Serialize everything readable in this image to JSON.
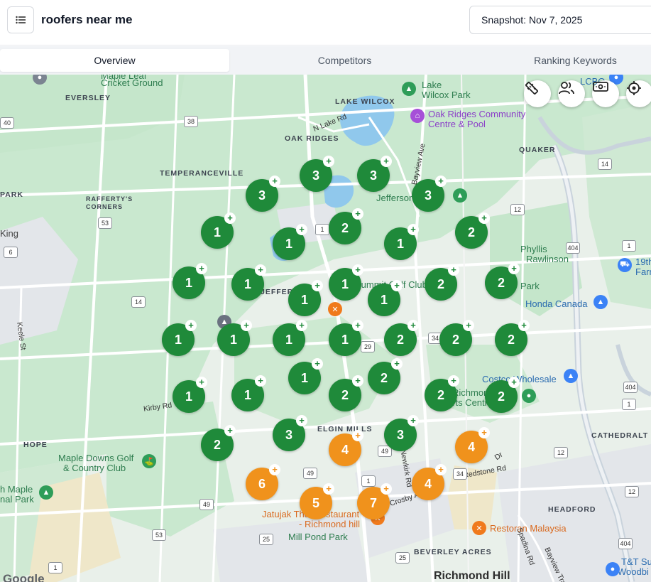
{
  "header": {
    "title": "roofers near me",
    "snapshot": "Snapshot: Nov 7, 2025"
  },
  "tabs": [
    {
      "label": "Overview",
      "active": true
    },
    {
      "label": "Competitors",
      "active": false
    },
    {
      "label": "Ranking Keywords",
      "active": false
    }
  ],
  "colors": {
    "green_marker": "#1f8a3a",
    "orange_marker": "#f0921c",
    "park": "#c9e8cf",
    "water": "#90c8ec",
    "road_major": "#ffffff",
    "highway": "#c9d3dc"
  },
  "map_controls": [
    {
      "name": "ruler-icon"
    },
    {
      "name": "people-icon"
    },
    {
      "name": "cash-icon"
    },
    {
      "name": "crosshair-icon"
    }
  ],
  "markers": [
    {
      "rank": "3"
    },
    {
      "rank": "3"
    },
    {
      "rank": "3"
    },
    {
      "rank": "3"
    },
    {
      "rank": "1"
    },
    {
      "rank": "1"
    },
    {
      "rank": "2"
    },
    {
      "rank": "1"
    },
    {
      "rank": "2"
    },
    {
      "rank": "1"
    },
    {
      "rank": "1"
    },
    {
      "rank": "1"
    },
    {
      "rank": "1"
    },
    {
      "rank": "1"
    },
    {
      "rank": "2"
    },
    {
      "rank": "2"
    },
    {
      "rank": "1"
    },
    {
      "rank": "1"
    },
    {
      "rank": "1"
    },
    {
      "rank": "1"
    },
    {
      "rank": "2"
    },
    {
      "rank": "2"
    },
    {
      "rank": "2"
    },
    {
      "rank": "1"
    },
    {
      "rank": "1"
    },
    {
      "rank": "1"
    },
    {
      "rank": "2"
    },
    {
      "rank": "2"
    },
    {
      "rank": "2"
    },
    {
      "rank": "2"
    },
    {
      "rank": "2"
    },
    {
      "rank": "3"
    },
    {
      "rank": "4"
    },
    {
      "rank": "3"
    },
    {
      "rank": "4"
    },
    {
      "rank": "6"
    },
    {
      "rank": "4"
    },
    {
      "rank": "5"
    },
    {
      "rank": "7"
    }
  ],
  "places": {
    "maple_leaf": "Maple Leaf",
    "cricket_ground": "Cricket Ground",
    "eversley": "EVERSLEY",
    "lake_wilcox_park_1": "Lake",
    "lake_wilcox_park_2": "Wilcox Park",
    "lake_wilcox": "LAKE WILCOX",
    "lcbo": "LCBO",
    "n_lake_rd": "N Lake Rd",
    "oak_ridges_cc_1": "Oak Ridges Community",
    "oak_ridges_cc_2": "Centre & Pool",
    "oak_ridges": "OAK RIDGES",
    "bayview_ave": "Bayview Ave",
    "quaker": "QUAKER",
    "temperanceville": "TEMPERANCEVILLE",
    "park": "PARK",
    "rafferty_1": "RAFFERTY'S",
    "rafferty_2": "CORNERS",
    "jefferson_p": "Jefferson",
    "king": "King",
    "phyllis_1": "Phyllis",
    "phyllis_2": "Rawlinson",
    "phyllis_3": "Park",
    "nineteenth_1": "19th",
    "nineteenth_2": "Farm",
    "jeffer": "JEFFER",
    "summit_golf": "Summit Golf Club",
    "honda": "Honda Canada",
    "keele": "Keele St",
    "costco": "Costco Wholesale",
    "richmond_green_1": "Richmond",
    "richmond_green_2": "Sports Centre and",
    "kirby": "Kirby Rd",
    "hope": "HOPE",
    "elgin_mills": "ELGIN MILLS",
    "cathedraltown": "CATHEDRALT",
    "maple_downs_1": "Maple Downs Golf",
    "maple_downs_2": "& Country Club",
    "newkirk": "Newkirk Rd",
    "redstone": "Redstone Rd",
    "maple_park_1": "h Maple",
    "maple_park_2": "nal Park",
    "crosby": "Crosby Ave",
    "jatujak_1": "Jatujak Thai Restaurant",
    "jatujak_2": "- Richmond hill",
    "mill_pond": "Mill Pond Park",
    "headford": "HEADFORD",
    "restoran": "Restoran Malaysia",
    "beverley": "BEVERLEY ACRES",
    "richmond_hill": "Richmond Hill",
    "spadina": "Spadina Rd",
    "bayview_trail": "Bayview Trail",
    "tt_1": "T&T Supe",
    "tt_2": "Woodbi",
    "dr": "Dr",
    "google": "Google"
  },
  "shields": [
    "40",
    "38",
    "53",
    "6",
    "14",
    "1",
    "12",
    "14",
    "404",
    "1",
    "29",
    "34",
    "1",
    "12",
    "49",
    "49",
    "1",
    "34",
    "49",
    "53",
    "25",
    "25",
    "1",
    "404",
    "12",
    "404"
  ]
}
